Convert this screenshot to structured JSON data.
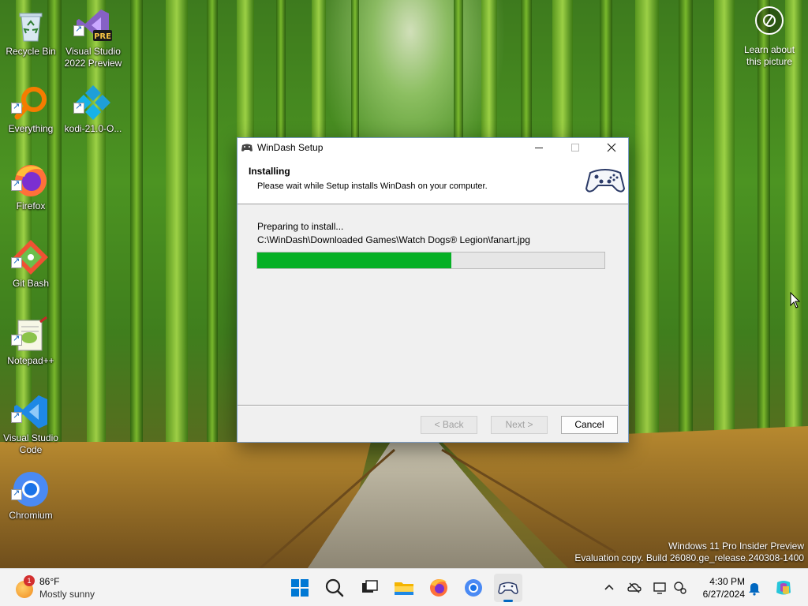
{
  "desktop": {
    "icons": [
      {
        "label": "Recycle Bin",
        "icon": "recycle-bin-icon"
      },
      {
        "label": "Visual Studio 2022 Preview",
        "icon": "visual-studio-preview-icon",
        "badge": "PRE"
      },
      {
        "label": "Everything",
        "icon": "everything-search-icon"
      },
      {
        "label": "kodi-21.0-O...",
        "icon": "kodi-icon"
      },
      {
        "label": "Firefox",
        "icon": "firefox-icon"
      },
      {
        "label": "Git Bash",
        "icon": "git-bash-icon"
      },
      {
        "label": "Notepad++",
        "icon": "notepadpp-icon"
      },
      {
        "label": "Visual Studio Code",
        "icon": "vscode-icon"
      },
      {
        "label": "Chromium",
        "icon": "chromium-icon"
      }
    ],
    "learn_label": "Learn about this picture",
    "watermark": {
      "line1": "Windows 11 Pro Insider Preview",
      "line2": "Evaluation copy. Build 26080.ge_release.240308-1400"
    }
  },
  "setup_window": {
    "title": "WinDash Setup",
    "heading": "Installing",
    "subheading": "Please wait while Setup installs WinDash on your computer.",
    "status": "Preparing to install...",
    "file_path": "C:\\WinDash\\Downloaded Games\\Watch Dogs® Legion\\fanart.jpg",
    "progress_fraction": 0.56,
    "progress_color": "#06b025",
    "buttons": {
      "back": "< Back",
      "next": "Next >",
      "cancel": "Cancel"
    }
  },
  "taskbar": {
    "weather": {
      "temp": "86°F",
      "condition": "Mostly sunny",
      "badge": "1"
    },
    "pinned": [
      "windows-start-icon",
      "search-icon",
      "task-view-icon",
      "file-explorer-icon",
      "firefox-icon",
      "chromium-icon",
      "windash-icon"
    ],
    "tray": [
      "chevron-up-icon",
      "onedrive-icon",
      "display-icon",
      "accessibility-icon"
    ],
    "clock": {
      "time": "4:30 PM",
      "date": "6/27/2024"
    }
  }
}
